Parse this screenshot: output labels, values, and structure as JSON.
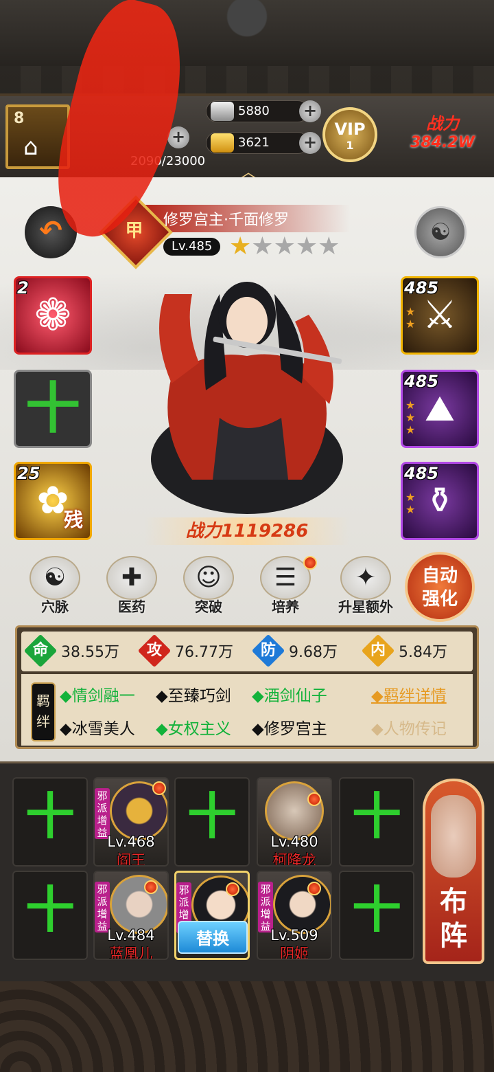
{
  "player": {
    "level": "8",
    "badge_icon": "pagoda-icon"
  },
  "resources": {
    "silver": {
      "value": "5880",
      "icon": "silver-ingot-icon"
    },
    "gold": {
      "value": "3621",
      "icon": "gold-ingot-icon"
    },
    "exp": "2090/23000",
    "plus": "+"
  },
  "vip": {
    "label": "VIP",
    "level": "1"
  },
  "top_power": {
    "label": "战力",
    "value": "384.2W"
  },
  "hero": {
    "name": "修罗宫主·千面修罗",
    "level": "Lv.485",
    "rank_badge": "甲",
    "stars_total": 5,
    "stars_filled": 1,
    "power": "战力1119286"
  },
  "left_slots": [
    {
      "num": "2",
      "icon": "rose-spiral-icon",
      "kind": "red"
    },
    {
      "num": "",
      "icon": "plus-icon",
      "kind": "empty"
    },
    {
      "num": "25",
      "icon": "golden-flower-icon",
      "kind": "gold",
      "frag": "残"
    }
  ],
  "right_slots": [
    {
      "num": "485",
      "icon": "sword-icon",
      "kind": "goldright"
    },
    {
      "num": "485",
      "icon": "cloak-icon",
      "kind": "purple"
    },
    {
      "num": "485",
      "icon": "wine-pot-icon",
      "kind": "purple"
    }
  ],
  "functions": [
    {
      "label": "穴脉",
      "icon": "meridian-icon"
    },
    {
      "label": "医药",
      "icon": "mushroom-icon"
    },
    {
      "label": "突破",
      "icon": "breakthrough-icon"
    },
    {
      "label": "培养",
      "icon": "scroll-icon"
    },
    {
      "label": "升星额外",
      "icon": "gift-icon"
    }
  ],
  "auto_strengthen": {
    "line1": "自动",
    "line2": "强化"
  },
  "stats": [
    {
      "key": "命",
      "value": "38.55万",
      "color": "#1aa53a"
    },
    {
      "key": "攻",
      "value": "76.77万",
      "color": "#d0261c"
    },
    {
      "key": "防",
      "value": "9.68万",
      "color": "#1e7ad8"
    },
    {
      "key": "内",
      "value": "5.84万",
      "color": "#e8a41c"
    }
  ],
  "bonds": {
    "tag": "羁绊",
    "row1": [
      {
        "text": "◆情剑融一",
        "active": true
      },
      {
        "text": "◆至臻巧剑",
        "active": false
      },
      {
        "text": "◆酒剑仙子",
        "active": true
      }
    ],
    "row2": [
      {
        "text": "◆冰雪美人",
        "active": false
      },
      {
        "text": "◆女权主义",
        "active": true
      },
      {
        "text": "◆修罗宫主",
        "active": false
      }
    ],
    "detail_link": "◆羁绊详情",
    "bio_link": "◆人物传记"
  },
  "formation": {
    "row1": [
      {
        "type": "empty"
      },
      {
        "type": "hero",
        "level": "Lv.468",
        "name": "阎王",
        "faction": "邪派增益"
      },
      {
        "type": "empty"
      },
      {
        "type": "hero",
        "level": "Lv.480",
        "name": "柯降龙",
        "faction": ""
      },
      {
        "type": "empty"
      }
    ],
    "row2": [
      {
        "type": "empty"
      },
      {
        "type": "hero",
        "level": "Lv.484",
        "name": "蓝凰儿",
        "faction": "邪派增益"
      },
      {
        "type": "selected",
        "faction": "邪派增",
        "button": "替换"
      },
      {
        "type": "hero",
        "level": "Lv.509",
        "name": "阴姬",
        "faction": "邪派增益"
      },
      {
        "type": "empty"
      }
    ],
    "lineup_button": "布阵"
  },
  "colors": {
    "accent_red": "#d63a14",
    "gold": "#e8b020",
    "green": "#2ecf2e"
  }
}
